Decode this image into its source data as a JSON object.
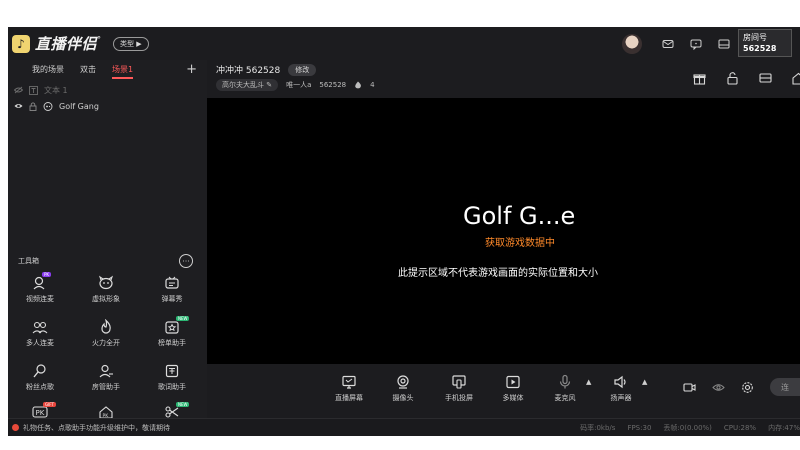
{
  "app": {
    "name": "直播伴侣",
    "type_button": "类型 ▶"
  },
  "room_badge": {
    "label": "房间号",
    "number": "562528"
  },
  "scene_tabs": [
    "我的场景",
    "双击",
    "场景1"
  ],
  "sources": [
    {
      "label": "文本 1",
      "dim": true
    },
    {
      "label": "Golf Gang",
      "dim": false
    }
  ],
  "toolbox": {
    "title": "工具箱",
    "tools": [
      {
        "label": "视频连麦",
        "icon": "video-link-icon",
        "tag": "PK"
      },
      {
        "label": "虚拟形象",
        "icon": "virtual-avatar-icon",
        "tag": ""
      },
      {
        "label": "弹幕秀",
        "icon": "danmaku-show-icon",
        "tag": ""
      },
      {
        "label": "多人连麦",
        "icon": "multi-link-icon",
        "tag": ""
      },
      {
        "label": "火力全开",
        "icon": "fire-icon",
        "tag": ""
      },
      {
        "label": "榜单助手",
        "icon": "rank-assistant-icon",
        "tag": "NEW"
      },
      {
        "label": "粉丝点歌",
        "icon": "fan-song-icon",
        "tag": ""
      },
      {
        "label": "房管助手",
        "icon": "room-manager-icon",
        "tag": ""
      },
      {
        "label": "歌词助手",
        "icon": "lyrics-assistant-icon",
        "tag": ""
      },
      {
        "label": "",
        "icon": "pk-icon",
        "tag": "GIFT"
      },
      {
        "label": "",
        "icon": "pk-home-icon",
        "tag": ""
      },
      {
        "label": "",
        "icon": "scissors-icon",
        "tag": "NEW"
      }
    ]
  },
  "stream": {
    "title": "冲冲冲 562528",
    "edit_label": "修改",
    "category": "高尔夫大乱斗 ✎",
    "user": "唯一人a",
    "room": "562528",
    "hot": "4"
  },
  "preview": {
    "game_title": "Golf G...e",
    "loading_text": "获取游戏数据中",
    "note": "此提示区域不代表游戏画面的实际位置和大小"
  },
  "bottom_controls": [
    {
      "label": "直播屏幕",
      "icon": "screen-icon"
    },
    {
      "label": "摄像头",
      "icon": "camera-icon"
    },
    {
      "label": "手机投屏",
      "icon": "phone-cast-icon"
    },
    {
      "label": "多媒体",
      "icon": "media-icon"
    },
    {
      "label": "麦克风",
      "icon": "microphone-icon"
    },
    {
      "label": "扬声器",
      "icon": "speaker-icon"
    }
  ],
  "golive_label": "连",
  "status": {
    "message": "礼物任务、点歌助手功能升级维护中，敬请期待",
    "bitrate": "码率:0kb/s",
    "fps": "FPS:30",
    "dropped": "丢帧:0(0.00%)",
    "cpu": "CPU:28%",
    "mem": "内存:47%"
  }
}
